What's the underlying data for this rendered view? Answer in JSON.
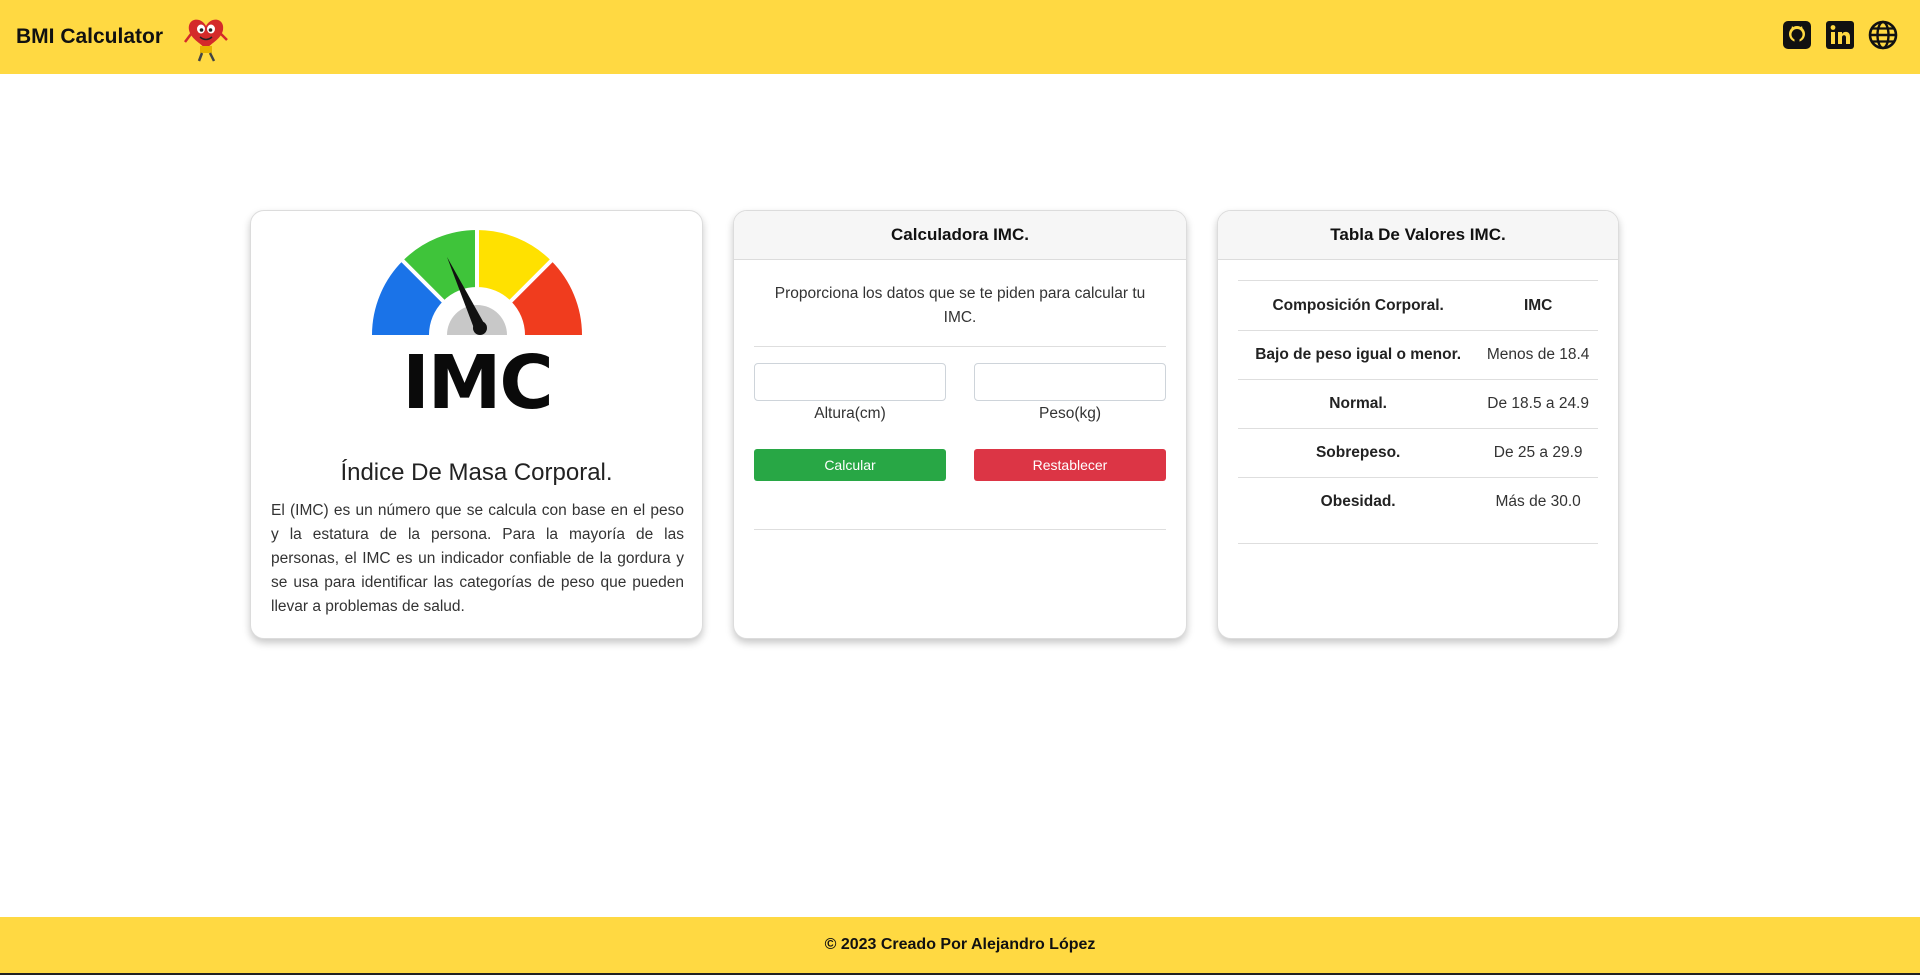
{
  "navbar": {
    "brand": "BMI Calculator",
    "icons": [
      "github-icon",
      "linkedin-icon",
      "globe-icon"
    ]
  },
  "info_card": {
    "logo_text": "IMC",
    "title": "Índice De Masa Corporal.",
    "description": "El (IMC) es un número que se calcula con base en el peso y la estatura de la persona. Para la mayoría de las personas, el IMC es un indicador confiable de la gordura y se usa para identificar las categorías de peso que pueden llevar a problemas de salud."
  },
  "calc_card": {
    "header": "Calculadora IMC.",
    "description": "Proporciona los datos que se te piden para calcular tu IMC.",
    "height_input": {
      "value": "",
      "label": "Altura(cm)"
    },
    "weight_input": {
      "value": "",
      "label": "Peso(kg)"
    },
    "calculate_label": "Calcular",
    "reset_label": "Restablecer"
  },
  "table_card": {
    "header": "Tabla De Valores IMC.",
    "columns": [
      "Composición Corporal.",
      "IMC"
    ],
    "rows": [
      [
        "Bajo de peso igual o menor.",
        "Menos de 18.4"
      ],
      [
        "Normal.",
        "De 18.5 a 24.9"
      ],
      [
        "Sobrepeso.",
        "De 25 a 29.9"
      ],
      [
        "Obesidad.",
        "Más de 30.0"
      ]
    ]
  },
  "footer": {
    "text": "© 2023 Creado Por Alejandro López"
  },
  "colors": {
    "accent_yellow": "#ffd942",
    "success": "#28a745",
    "danger": "#dc3545",
    "gauge_blue": "#1a73e8",
    "gauge_green": "#3fc43a",
    "gauge_yellow": "#ffe100",
    "gauge_red": "#f03c1e"
  }
}
